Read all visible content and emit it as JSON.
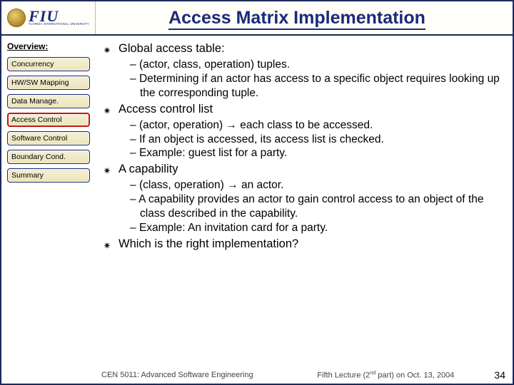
{
  "logo": {
    "text": "FIU",
    "sub": "FLORIDA INTERNATIONAL UNIVERSITY"
  },
  "title": "Access Matrix Implementation",
  "sidebar": {
    "heading": "Overview:",
    "items": [
      {
        "label": "Concurrency",
        "active": false
      },
      {
        "label": "HW/SW Mapping",
        "active": false
      },
      {
        "label": "Data Manage.",
        "active": false
      },
      {
        "label": "Access Control",
        "active": true
      },
      {
        "label": "Software Control",
        "active": false
      },
      {
        "label": "Boundary Cond.",
        "active": false
      },
      {
        "label": "Summary",
        "active": false
      }
    ]
  },
  "content": {
    "b1": {
      "title": "Global access table:",
      "s1": "(actor, class, operation) tuples.",
      "s2": "Determining if an actor has access to a specific object requires looking up the corresponding tuple."
    },
    "b2": {
      "title": "Access control list",
      "s1a": "(actor, operation) ",
      "s1b": " each class to be accessed.",
      "s2": "If an object is accessed, its access list is checked.",
      "s3": "Example: guest list for a party."
    },
    "b3": {
      "title": "A capability",
      "s1a": "(class, operation) ",
      "s1b": " an actor.",
      "s2": "A capability provides an actor to gain control access to an object of the class described in the capability.",
      "s3": "Example: An invitation card for a party."
    },
    "b4": {
      "title": "Which is the right implementation?"
    }
  },
  "footer": {
    "course": "CEN 5011: Advanced Software Engineering",
    "lecture_pre": "Fifth Lecture (2",
    "lecture_sup": "nd",
    "lecture_post": " part) on Oct. 13, 2004",
    "page": "34"
  }
}
